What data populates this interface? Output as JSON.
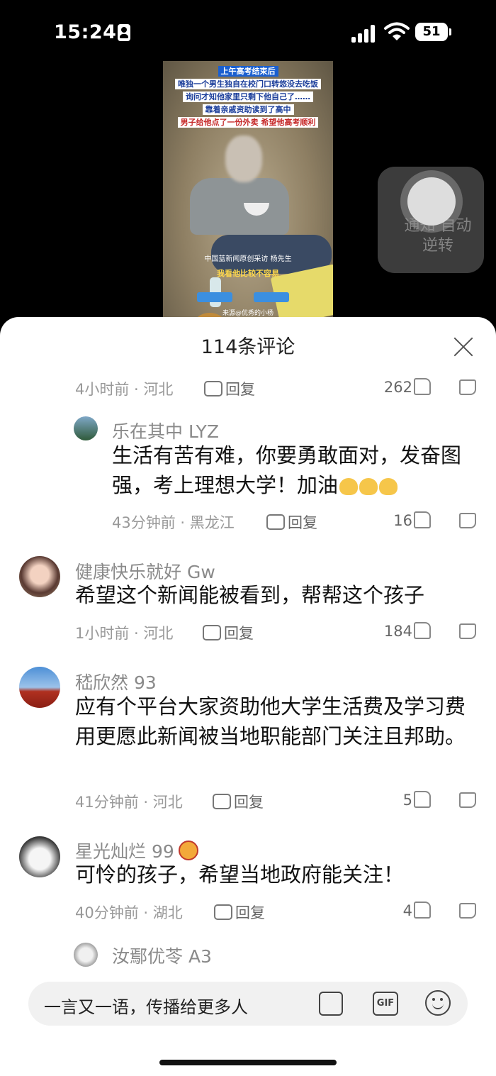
{
  "status": {
    "time": "15:24",
    "battery": "51"
  },
  "video": {
    "captions": [
      {
        "text": "上午高考结束后",
        "bg": "#1a5fd0",
        "fg": "#ffffff"
      },
      {
        "text": "唯独一个男生独自在校门口转悠没去吃饭",
        "bg": "#ffffff",
        "fg": "#1a3d9a"
      },
      {
        "text": "询问才知他家里只剩下他自己了……",
        "bg": "#ffffff",
        "fg": "#1a3d9a"
      },
      {
        "text": "靠着亲戚资助读到了高中",
        "bg": "#ffffff",
        "fg": "#1a3d9a"
      },
      {
        "text": "男子给他点了一份外卖 希望他高考顺利",
        "bg": "#ffffff",
        "fg": "#c62828"
      }
    ],
    "credit": "中国蓝新闻原创采访 杨先生",
    "quote": "我看他比较不容易",
    "source": "来源@优秀的小杨"
  },
  "float_widget": {
    "ghost_text": "通知 自动逆转"
  },
  "sheet": {
    "title": "114条评论"
  },
  "comments": [
    {
      "meta": "4小时前 · 河北",
      "reply": "回复",
      "likes": "262"
    },
    {
      "user": "乐在其中 LYZ",
      "text": "生活有苦有难，你要勇敢面对，发奋图强，考上理想大学！加油",
      "meta": "43分钟前 · 黑龙江",
      "reply": "回复",
      "likes": "16"
    },
    {
      "user": "健康快乐就好 Gw",
      "text": "希望这个新闻能被看到，帮帮这个孩子",
      "meta": "1小时前 · 河北",
      "reply": "回复",
      "likes": "184"
    },
    {
      "user": "嵇欣然 93",
      "text": "应有个平台大家资助他大学生活费及学习费用更愿此新闻被当地职能部门关注且邦助。",
      "meta": "41分钟前 · 河北",
      "reply": "回复",
      "likes": "5"
    },
    {
      "user": "星光灿烂 99",
      "text": "可怜的孩子，希望当地政府能关注！",
      "meta": "40分钟前 · 湖北",
      "reply": "回复",
      "likes": "4"
    },
    {
      "user": "汝鄢优苓 A3"
    }
  ],
  "input": {
    "placeholder": "一言又一语，传播给更多人",
    "gif": "GIF"
  }
}
